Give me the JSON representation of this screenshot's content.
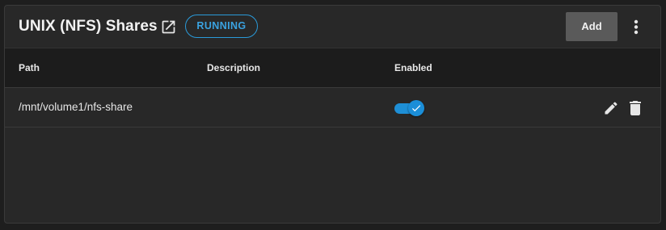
{
  "card": {
    "title": "UNIX (NFS) Shares",
    "status": "RUNNING",
    "add_label": "Add",
    "icons": {
      "open": "open-in-new-icon",
      "more": "more-vert-icon"
    }
  },
  "table": {
    "columns": [
      "Path",
      "Description",
      "Enabled"
    ],
    "rows": [
      {
        "path": "/mnt/volume1/nfs-share",
        "description": "",
        "enabled": true,
        "actions": [
          "edit-icon",
          "delete-icon"
        ]
      }
    ]
  },
  "colors": {
    "accent": "#1e8fd6",
    "badge": "#3aa2e0",
    "button_bg": "#5a5a5a",
    "card_bg": "#282828",
    "header_bg": "#1c1c1c"
  }
}
